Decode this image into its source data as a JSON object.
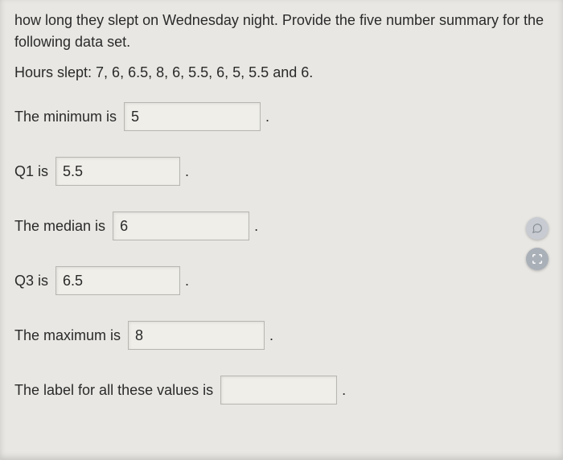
{
  "intro": {
    "line1": "how long they slept on Wednesday night.  Provide the five number summary for the",
    "line2": "following data set."
  },
  "dataset": "Hours slept:  7, 6, 6.5, 8, 6, 5.5, 6, 5, 5.5 and 6.",
  "rows": {
    "minimum": {
      "label": "The minimum is ",
      "value": "5"
    },
    "q1": {
      "label": "Q1 is ",
      "value": "5.5"
    },
    "median": {
      "label": "The median is ",
      "value": "6"
    },
    "q3": {
      "label": "Q3 is ",
      "value": "6.5"
    },
    "maximum": {
      "label": "The maximum is ",
      "value": "8"
    },
    "label_values": {
      "label": "The label for all these values is ",
      "value": ""
    }
  },
  "period": "."
}
